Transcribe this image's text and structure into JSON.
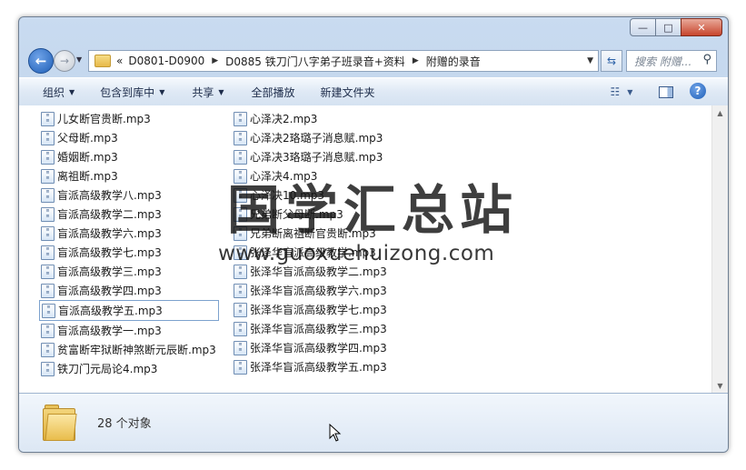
{
  "window": {
    "controls": {
      "minimize": "—",
      "maximize": "□",
      "close": "✕"
    }
  },
  "nav": {
    "back_icon": "arrow-left-icon",
    "forward_icon": "arrow-right-icon",
    "breadcrumbs": [
      "«",
      "D0801-D0900",
      "D0885 铁刀门八字弟子班录音+资料",
      "附赠的录音"
    ],
    "search_placeholder": "搜索 附赠..."
  },
  "toolbar": {
    "organize": "组织",
    "include_in_library": "包含到库中",
    "share": "共享",
    "play_all": "全部播放",
    "new_folder": "新建文件夹"
  },
  "files": {
    "column1": [
      "儿女断官贵断.mp3",
      "父母断.mp3",
      "婚姻断.mp3",
      "离祖断.mp3",
      "盲派高级教学八.mp3",
      "盲派高级教学二.mp3",
      "盲派高级教学六.mp3",
      "盲派高级教学七.mp3",
      "盲派高级教学三.mp3",
      "盲派高级教学四.mp3",
      "盲派高级教学五.mp3",
      "盲派高级教学一.mp3",
      "贫富断牢狱断神煞断元辰断.mp3",
      "铁刀门元局论4.mp3"
    ],
    "column2": [
      "心泽决2.mp3",
      "心泽决2珞璐子消息赋.mp3",
      "心泽决3珞璐子消息赋.mp3",
      "心泽决4.mp3",
      "心泽决10.mp3",
      "兄弟断父母断.mp3",
      "兄弟断离祖断官贵断.mp3",
      "张泽华盲派高级教学.mp3",
      "张泽华盲派高级教学二.mp3",
      "张泽华盲派高级教学六.mp3",
      "张泽华盲派高级教学七.mp3",
      "张泽华盲派高级教学三.mp3",
      "张泽华盲派高级教学四.mp3",
      "张泽华盲派高级教学五.mp3"
    ],
    "selected_index": 10
  },
  "details": {
    "count": "28 个对象"
  },
  "watermark": {
    "title": "国学汇总站",
    "url": "www.guoxuehuizong.com"
  }
}
